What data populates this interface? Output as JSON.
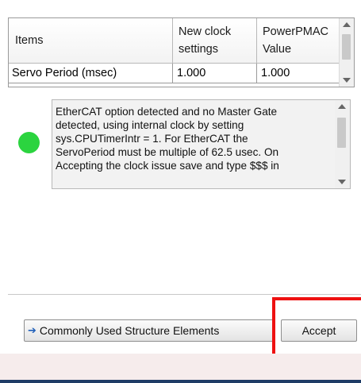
{
  "clock_table": {
    "headers": [
      "Items",
      "New clock\nsettings",
      "PowerPMAC\nValue"
    ],
    "rows": [
      {
        "item": "Servo Period (msec)",
        "new_value": "1.000",
        "pmac_value": "1.000"
      }
    ]
  },
  "status": {
    "indicator_color": "#2bd43f",
    "message": "EtherCAT option detected and no Master Gate\ndetected, using internal clock by setting\nsys.CPUTimerIntr = 1.  For EtherCAT the\nServoPeriod must be multiple of 62.5 usec. On\nAccepting the clock issue save and type $$$ in"
  },
  "buttons": {
    "structure_label": "Commonly Used Structure Elements",
    "structure_icon": "arrow-right-icon",
    "accept_label": "Accept"
  },
  "colors": {
    "highlight": "#ee1111",
    "accent": "#1f5fb9"
  }
}
